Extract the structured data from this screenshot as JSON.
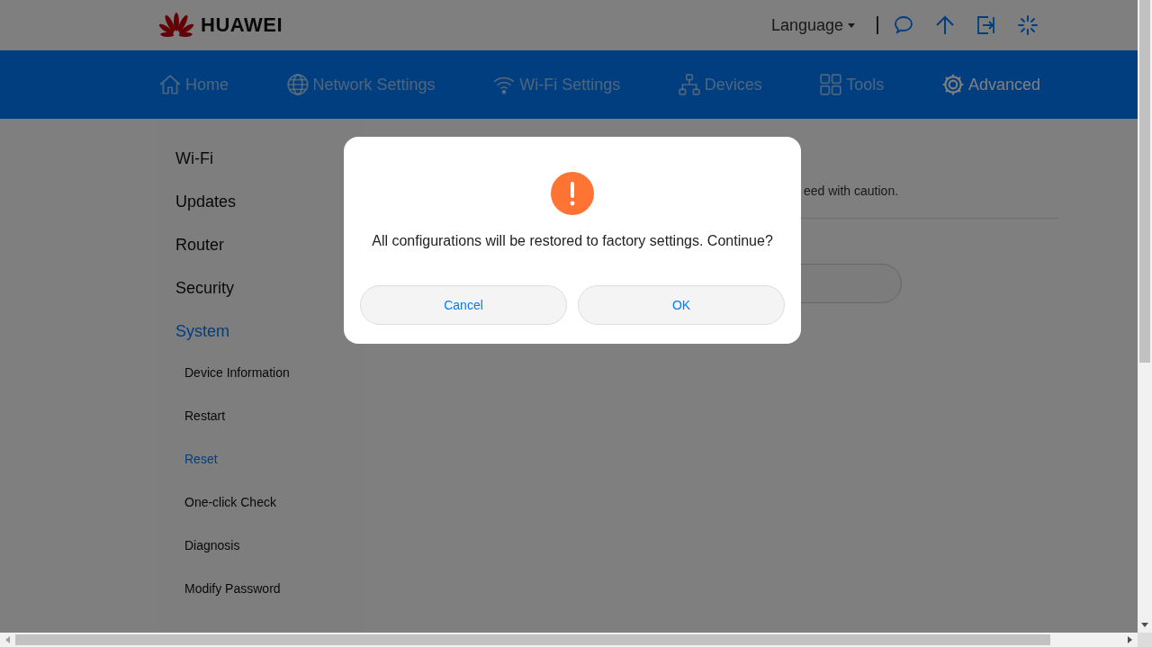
{
  "header": {
    "logo": "HUAWEI",
    "language": "Language"
  },
  "nav": [
    {
      "label": "Home",
      "selected": false
    },
    {
      "label": "Network Settings",
      "selected": false
    },
    {
      "label": "Wi-Fi Settings",
      "selected": false
    },
    {
      "label": "Devices",
      "selected": false
    },
    {
      "label": "Tools",
      "selected": false
    },
    {
      "label": "Advanced",
      "selected": true
    }
  ],
  "sidebar": [
    {
      "label": "Wi-Fi",
      "selected": false
    },
    {
      "label": "Updates",
      "selected": false
    },
    {
      "label": "Router",
      "selected": false
    },
    {
      "label": "Security",
      "selected": false
    },
    {
      "label": "System",
      "selected": true,
      "children": [
        {
          "label": "Device Information",
          "selected": false
        },
        {
          "label": "Restart",
          "selected": false
        },
        {
          "label": "Reset",
          "selected": true
        },
        {
          "label": "One-click Check",
          "selected": false
        },
        {
          "label": "Diagnosis",
          "selected": false
        },
        {
          "label": "Modify Password",
          "selected": false
        }
      ]
    }
  ],
  "content": {
    "note": "eed with caution."
  },
  "dialog": {
    "message": "All configurations will be restored to factory settings. Continue?",
    "buttons": [
      {
        "label": "Cancel"
      },
      {
        "label": "OK"
      }
    ]
  }
}
